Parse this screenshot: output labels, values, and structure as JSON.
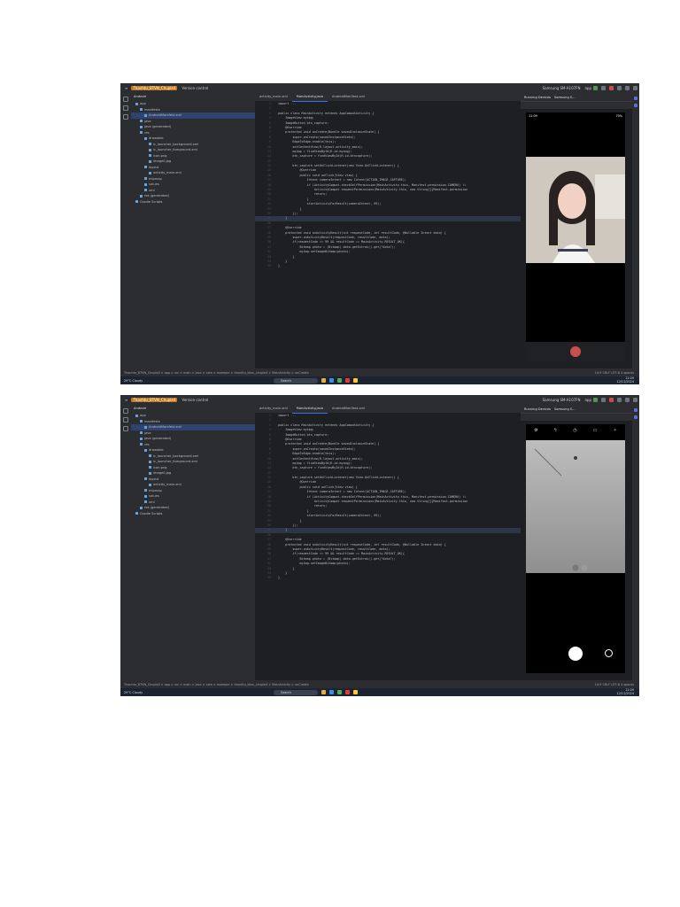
{
  "ide": {
    "project_name": "Thanhtu_BTVN_Chuple4",
    "vcs": "Version control",
    "device": "Samsung SM-A107FN",
    "run_config": "app",
    "project_view": "Android",
    "tabs": [
      "activity_main.xml",
      "MainActivity.java",
      "AndroidManifest.xml"
    ],
    "running_devices_label": "Running Devices",
    "device_tab": "Samsung S...",
    "tree": [
      {
        "label": "app",
        "selected": false
      },
      {
        "label": "manifests",
        "selected": false
      },
      {
        "label": "AndroidManifest.xml",
        "selected": true
      },
      {
        "label": "java",
        "selected": false
      },
      {
        "label": "java (generated)",
        "selected": false
      },
      {
        "label": "res",
        "selected": false
      },
      {
        "label": "drawable",
        "selected": false
      },
      {
        "label": "ic_launcher_background.xml",
        "selected": false
      },
      {
        "label": "ic_launcher_foreground.xml",
        "selected": false
      },
      {
        "label": "icon.png",
        "selected": false
      },
      {
        "label": "image0.jpg",
        "selected": false
      },
      {
        "label": "layout",
        "selected": false
      },
      {
        "label": "activity_main.xml",
        "selected": false
      },
      {
        "label": "mipmap",
        "selected": false
      },
      {
        "label": "values",
        "selected": false
      },
      {
        "label": "xml",
        "selected": false
      },
      {
        "label": "res (generated)",
        "selected": false
      },
      {
        "label": "Gradle Scripts",
        "selected": false
      }
    ],
    "code_lines": [
      "import ...",
      "",
      "public class MainActivity extends AppCompatActivity {",
      "    ImageView myimg;",
      "    ImageButton btn_capture;",
      "    @Override",
      "    protected void onCreate(Bundle savedInstanceState) {",
      "        super.onCreate(savedInstanceState);",
      "        EdgeToEdge.enable(this);",
      "        setContentView(R.layout.activity_main);",
      "        myimg = findViewById(R.id.myimg);",
      "        btn_capture = findViewById(R.id.btncapture);",
      "",
      "        btn_capture.setOnClickListener(new View.OnClickListener() {",
      "            @Override",
      "            public void onClick(View view) {",
      "                Intent cameraIntent = new Intent(ACTION_IMAGE_CAPTURE);",
      "                if (ActivityCompat.checkSelfPermission(MainActivity.this, Manifest.permission.CAMERA) !=",
      "                    ActivityCompat.requestPermissions(MainActivity.this, new String[]{Manifest.permission",
      "                    return;",
      "                }",
      "                startActivityForResult(cameraIntent, 99);",
      "            }",
      "        });",
      "    }",
      "",
      "    @Override",
      "    protected void onActivityResult(int requestCode, int resultCode, @Nullable Intent data) {",
      "        super.onActivityResult(requestCode, resultCode, data);",
      "        if(requestCode == 99 && resultCode == MainActivity.RESULT_OK){",
      "            Bitmap photo = (Bitmap) data.getExtras().get(\"data\");",
      "            myimg.setImageBitmap(photo);",
      "        }",
      "    }",
      "}"
    ],
    "breadcrumb": "Thanhtu_BTVN_Chuple4 > app > src > main > java > com > example > thanhtu_btvn_chuple4 > MainActivity > onCreate",
    "status_right": "14:9  CRLF  UTF-8  4 spaces",
    "phone_time": "11:09",
    "phone_battery": "70%"
  },
  "taskbar": {
    "weather_temp": "29°C",
    "weather_desc": "Cloudy",
    "search": "Search",
    "time": "11:09",
    "date": "12/11/2024"
  },
  "colors": {
    "ide_bg": "#1e1f22",
    "panel_bg": "#2b2d30",
    "accent": "#3574f0",
    "shutter_red": "#c94f4f"
  }
}
